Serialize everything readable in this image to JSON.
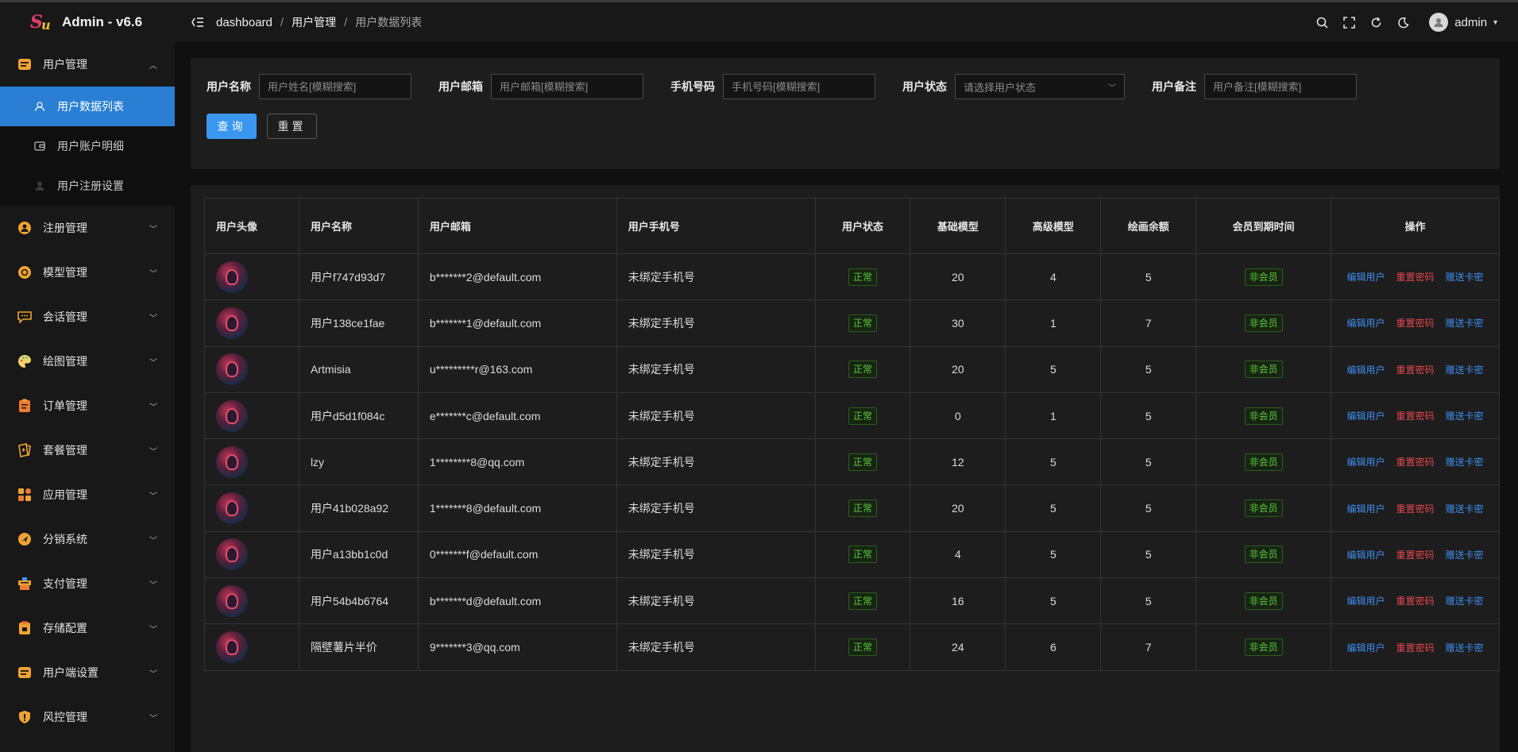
{
  "app": {
    "title": "Admin - v6.6"
  },
  "header": {
    "breadcrumb": [
      "dashboard",
      "用户管理",
      "用户数据列表"
    ],
    "user": "admin"
  },
  "sidebar": {
    "items": [
      {
        "label": "用户管理",
        "icon": "user-card-icon",
        "expanded": true
      },
      {
        "label": "注册管理",
        "icon": "register-icon"
      },
      {
        "label": "模型管理",
        "icon": "model-icon"
      },
      {
        "label": "会话管理",
        "icon": "chat-icon"
      },
      {
        "label": "绘图管理",
        "icon": "palette-icon"
      },
      {
        "label": "订单管理",
        "icon": "order-icon"
      },
      {
        "label": "套餐管理",
        "icon": "package-icon"
      },
      {
        "label": "应用管理",
        "icon": "apps-icon"
      },
      {
        "label": "分销系统",
        "icon": "distribution-icon"
      },
      {
        "label": "支付管理",
        "icon": "payment-icon"
      },
      {
        "label": "存储配置",
        "icon": "storage-icon"
      },
      {
        "label": "用户端设置",
        "icon": "client-settings-icon"
      },
      {
        "label": "风控管理",
        "icon": "shield-icon"
      }
    ],
    "sub_items": [
      {
        "label": "用户数据列表",
        "active": true
      },
      {
        "label": "用户账户明细"
      },
      {
        "label": "用户注册设置"
      }
    ]
  },
  "search": {
    "name_label": "用户名称",
    "name_placeholder": "用户姓名[模糊搜索]",
    "email_label": "用户邮箱",
    "email_placeholder": "用户邮箱[模糊搜索]",
    "phone_label": "手机号码",
    "phone_placeholder": "手机号码[模糊搜索]",
    "status_label": "用户状态",
    "status_placeholder": "请选择用户状态",
    "remark_label": "用户备注",
    "remark_placeholder": "用户备注[模糊搜索]",
    "query_button": "查询",
    "reset_button": "重置"
  },
  "table": {
    "columns": [
      "用户头像",
      "用户名称",
      "用户邮箱",
      "用户手机号",
      "用户状态",
      "基础模型",
      "高级模型",
      "绘画余额",
      "会员到期时间",
      "操作"
    ],
    "actions": {
      "edit": "编辑用户",
      "reset": "重置密码",
      "gift": "赠送卡密"
    },
    "rows": [
      {
        "name": "用户f747d93d7",
        "email": "b*******2@default.com",
        "phone": "未绑定手机号",
        "status": "正常",
        "basic": "20",
        "advanced": "4",
        "draw": "5",
        "member": "非会员"
      },
      {
        "name": "用户138ce1fae",
        "email": "b*******1@default.com",
        "phone": "未绑定手机号",
        "status": "正常",
        "basic": "30",
        "advanced": "1",
        "draw": "7",
        "member": "非会员"
      },
      {
        "name": "Artmisia",
        "email": "u*********r@163.com",
        "phone": "未绑定手机号",
        "status": "正常",
        "basic": "20",
        "advanced": "5",
        "draw": "5",
        "member": "非会员"
      },
      {
        "name": "用户d5d1f084c",
        "email": "e*******c@default.com",
        "phone": "未绑定手机号",
        "status": "正常",
        "basic": "0",
        "advanced": "1",
        "draw": "5",
        "member": "非会员"
      },
      {
        "name": "lzy",
        "email": "1********8@qq.com",
        "phone": "未绑定手机号",
        "status": "正常",
        "basic": "12",
        "advanced": "5",
        "draw": "5",
        "member": "非会员"
      },
      {
        "name": "用户41b028a92",
        "email": "1*******8@default.com",
        "phone": "未绑定手机号",
        "status": "正常",
        "basic": "20",
        "advanced": "5",
        "draw": "5",
        "member": "非会员"
      },
      {
        "name": "用户a13bb1c0d",
        "email": "0*******f@default.com",
        "phone": "未绑定手机号",
        "status": "正常",
        "basic": "4",
        "advanced": "5",
        "draw": "5",
        "member": "非会员"
      },
      {
        "name": "用户54b4b6764",
        "email": "b*******d@default.com",
        "phone": "未绑定手机号",
        "status": "正常",
        "basic": "16",
        "advanced": "5",
        "draw": "5",
        "member": "非会员"
      },
      {
        "name": "隔壁薯片半价",
        "email": "9*******3@qq.com",
        "phone": "未绑定手机号",
        "status": "正常",
        "basic": "24",
        "advanced": "6",
        "draw": "7",
        "member": "非会员"
      }
    ]
  },
  "colors": {
    "accent": "#3a97f0",
    "active_menu": "#2a7fd4",
    "danger": "#e5484d",
    "success": "#5cc83b"
  }
}
